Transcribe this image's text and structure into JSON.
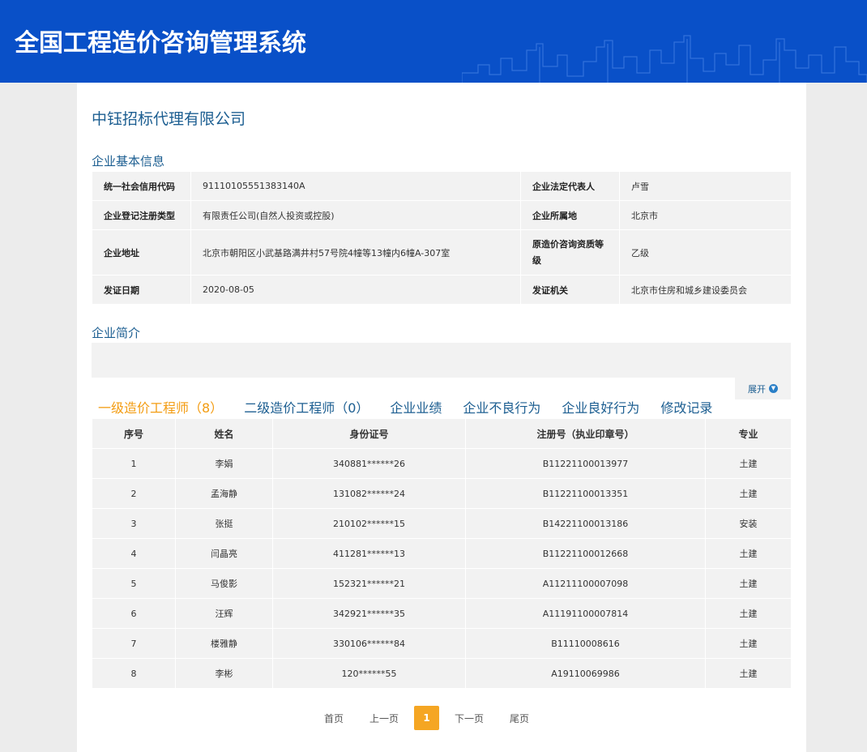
{
  "header": {
    "title": "全国工程造价咨询管理系统"
  },
  "company": {
    "name": "中钰招标代理有限公司"
  },
  "sections": {
    "basic_info": "企业基本信息",
    "intro": "企业简介"
  },
  "basic_info": [
    [
      {
        "label": "统一社会信用代码",
        "value": "91110105551383140A"
      },
      {
        "label": "企业法定代表人",
        "value": "卢雪"
      }
    ],
    [
      {
        "label": "企业登记注册类型",
        "value": "有限责任公司(自然人投资或控股)"
      },
      {
        "label": "企业所属地",
        "value": "北京市"
      }
    ],
    [
      {
        "label": "企业地址",
        "value": "北京市朝阳区小武基路满井村57号院4幢等13幢内6幢A-307室"
      },
      {
        "label": "原造价咨询资质等级",
        "value": "乙级"
      }
    ],
    [
      {
        "label": "发证日期",
        "value": "2020-08-05"
      },
      {
        "label": "发证机关",
        "value": "北京市住房和城乡建设委员会"
      }
    ]
  ],
  "intro": {
    "text": "",
    "expand_label": "展开"
  },
  "tabs": [
    {
      "label": "一级造价工程师（8）",
      "active": true
    },
    {
      "label": "二级造价工程师（0）",
      "active": false
    },
    {
      "label": "企业业绩",
      "active": false
    },
    {
      "label": "企业不良行为",
      "active": false
    },
    {
      "label": "企业良好行为",
      "active": false
    },
    {
      "label": "修改记录",
      "active": false
    }
  ],
  "engineers": {
    "columns": [
      "序号",
      "姓名",
      "身份证号",
      "注册号（执业印章号）",
      "专业"
    ],
    "rows": [
      [
        "1",
        "李娟",
        "340881******26",
        "B11221100013977",
        "土建"
      ],
      [
        "2",
        "孟海静",
        "131082******24",
        "B11221100013351",
        "土建"
      ],
      [
        "3",
        "张挺",
        "210102******15",
        "B14221100013186",
        "安装"
      ],
      [
        "4",
        "闫晶亮",
        "411281******13",
        "B11221100012668",
        "土建"
      ],
      [
        "5",
        "马俊影",
        "152321******21",
        "A11211100007098",
        "土建"
      ],
      [
        "6",
        "汪辉",
        "342921******35",
        "A11191100007814",
        "土建"
      ],
      [
        "7",
        "楼雅静",
        "330106******84",
        "B11110008616",
        "土建"
      ],
      [
        "8",
        "李彬",
        "120******55",
        "A19110069986",
        "土建"
      ]
    ]
  },
  "pager": {
    "first": "首页",
    "prev": "上一页",
    "current": "1",
    "next": "下一页",
    "last": "尾页"
  },
  "colors": {
    "header_bg": "#0950c8",
    "link": "#1c5e91",
    "accent": "#f39c12"
  }
}
